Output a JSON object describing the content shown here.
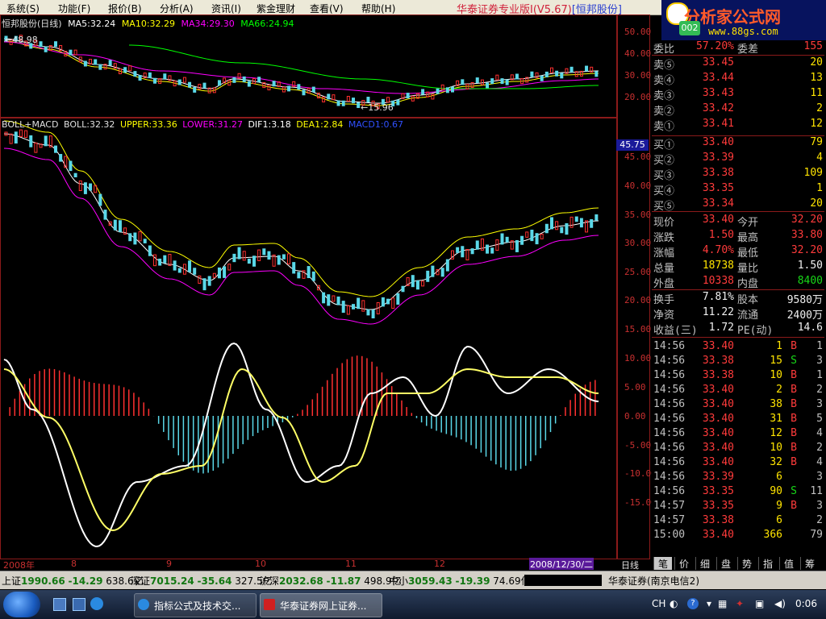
{
  "menu": {
    "items": [
      "系统(S)",
      "功能(F)",
      "报价(B)",
      "分析(A)",
      "资讯(I)",
      "紫金理财",
      "查看(V)",
      "帮助(H)"
    ],
    "app_title_prefix": "华泰证券专业版Ⅰ(V5.67)",
    "app_title_stock": "[恒邦股份]"
  },
  "logo": {
    "title": "分析家公式网",
    "url": "www.88gs.com",
    "badge": "002"
  },
  "chart": {
    "header": "恒邦股份(日线)",
    "ma5": "MA5:32.24",
    "ma10": "MA10:32.29",
    "ma34": "MA34:29.30",
    "ma66": "MA66:24.94",
    "high_mark": "48.98",
    "low_mark": "15.96",
    "indicator_header": "BOLL+MACD",
    "boll": "BOLL:32.32",
    "upper": "UPPER:33.36",
    "lower": "LOWER:31.27",
    "dif": "DIF1:3.18",
    "dea": "DEA1:2.84",
    "macd": "MACD1:0.67",
    "price_badge": "45.75",
    "yaxis_top": [
      "50.00",
      "40.00",
      "30.00",
      "20.00"
    ],
    "yaxis_mid": [
      "45.00",
      "40.00",
      "35.00",
      "30.00",
      "25.00",
      "20.00",
      "15.00"
    ],
    "yaxis_bot": [
      "10.00",
      "5.00",
      "0.00",
      "-5.00",
      "-10.00",
      "-15.00"
    ],
    "date_ticks": [
      "2008年",
      "8",
      "9",
      "10",
      "11",
      "12"
    ],
    "date_box": "2008/12/30/二",
    "period": "日线",
    "colors": {
      "ma5": "#ffffff",
      "ma10": "#ffff00",
      "ma34": "#ff00ff",
      "ma66": "#00ff00",
      "up": "#ff3030",
      "down": "#5ad8e8"
    }
  },
  "quote": {
    "wei_bi_label": "委比",
    "wei_bi": "57.20%",
    "wei_cha_label": "委差",
    "wei_cha": "155",
    "asks": [
      {
        "label": "卖⑤",
        "price": "33.45",
        "vol": "20"
      },
      {
        "label": "卖④",
        "price": "33.44",
        "vol": "13"
      },
      {
        "label": "卖③",
        "price": "33.43",
        "vol": "11"
      },
      {
        "label": "卖②",
        "price": "33.42",
        "vol": "2"
      },
      {
        "label": "卖①",
        "price": "33.41",
        "vol": "12"
      }
    ],
    "bids": [
      {
        "label": "买①",
        "price": "33.40",
        "vol": "79"
      },
      {
        "label": "买②",
        "price": "33.39",
        "vol": "4"
      },
      {
        "label": "买③",
        "price": "33.38",
        "vol": "109"
      },
      {
        "label": "买④",
        "price": "33.35",
        "vol": "1"
      },
      {
        "label": "买⑤",
        "price": "33.34",
        "vol": "20"
      }
    ],
    "stats": [
      {
        "l1": "现价",
        "v1": "33.40",
        "c1": "red",
        "l2": "今开",
        "v2": "32.20",
        "c2": "red"
      },
      {
        "l1": "涨跌",
        "v1": "1.50",
        "c1": "red",
        "l2": "最高",
        "v2": "33.80",
        "c2": "red"
      },
      {
        "l1": "涨幅",
        "v1": "4.70%",
        "c1": "red",
        "l2": "最低",
        "v2": "32.20",
        "c2": "red"
      },
      {
        "l1": "总量",
        "v1": "18738",
        "c1": "yel",
        "l2": "量比",
        "v2": "1.50",
        "c2": "wht"
      },
      {
        "l1": "外盘",
        "v1": "10338",
        "c1": "red",
        "l2": "内盘",
        "v2": "8400",
        "c2": "grn"
      }
    ],
    "stats2": [
      {
        "l1": "换手",
        "v1": "7.81%",
        "l2": "股本",
        "v2": "9580万"
      },
      {
        "l1": "净资",
        "v1": "11.22",
        "l2": "流通",
        "v2": "2400万"
      },
      {
        "l1": "收益(三)",
        "v1": "1.72",
        "l2": "PE(动)",
        "v2": "14.6"
      }
    ],
    "ticks": [
      {
        "time": "14:56",
        "price": "33.40",
        "vol": "1",
        "bs": "B",
        "n": "1"
      },
      {
        "time": "14:56",
        "price": "33.38",
        "vol": "15",
        "bs": "S",
        "n": "3"
      },
      {
        "time": "14:56",
        "price": "33.38",
        "vol": "10",
        "bs": "B",
        "n": "1"
      },
      {
        "time": "14:56",
        "price": "33.40",
        "vol": "2",
        "bs": "B",
        "n": "2"
      },
      {
        "time": "14:56",
        "price": "33.40",
        "vol": "38",
        "bs": "B",
        "n": "3"
      },
      {
        "time": "14:56",
        "price": "33.40",
        "vol": "31",
        "bs": "B",
        "n": "5"
      },
      {
        "time": "14:56",
        "price": "33.40",
        "vol": "12",
        "bs": "B",
        "n": "4"
      },
      {
        "time": "14:56",
        "price": "33.40",
        "vol": "10",
        "bs": "B",
        "n": "2"
      },
      {
        "time": "14:56",
        "price": "33.40",
        "vol": "32",
        "bs": "B",
        "n": "4"
      },
      {
        "time": "14:56",
        "price": "33.39",
        "vol": "6",
        "bs": "",
        "n": "3"
      },
      {
        "time": "14:56",
        "price": "33.35",
        "vol": "90",
        "bs": "S",
        "n": "11"
      },
      {
        "time": "14:57",
        "price": "33.35",
        "vol": "9",
        "bs": "B",
        "n": "3"
      },
      {
        "time": "14:57",
        "price": "33.38",
        "vol": "6",
        "bs": "",
        "n": "2"
      },
      {
        "time": "15:00",
        "price": "33.40",
        "vol": "366",
        "bs": "",
        "n": "79"
      }
    ]
  },
  "tabs": [
    "笔",
    "价",
    "细",
    "盘",
    "势",
    "指",
    "值",
    "筹"
  ],
  "status": {
    "sh_label": "上证",
    "sh_val": "1990.66",
    "sh_chg": "-14.29",
    "sh_amt": "638.6亿",
    "sz_label": "深证",
    "sz_val": "7015.24",
    "sz_chg": "-35.64",
    "sz_amt": "327.5亿",
    "hs_label": "沪深",
    "hs_val": "2032.68",
    "hs_chg": "-11.87",
    "hs_amt": "498.9亿",
    "zx_label": "中小",
    "zx_val": "3059.43",
    "zx_chg": "-19.39",
    "zx_amt": "74.69亿",
    "broker": "华泰证券(南京电信2)"
  },
  "taskbar": {
    "btn1": "指标公式及技术交...",
    "btn2": "华泰证券网上证券...",
    "lang": "CH",
    "clock": "0:06"
  }
}
